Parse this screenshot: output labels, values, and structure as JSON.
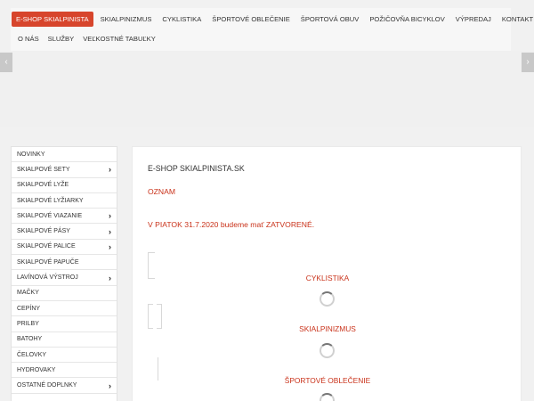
{
  "nav": {
    "row1": [
      "E-SHOP SKIALPINISTA",
      "SKIALPINIZMUS",
      "CYKLISTIKA",
      "ŠPORTOVÉ OBLEČENIE",
      "ŠPORTOVÁ OBUV",
      "POŽIČOVŇA BICYKLOV",
      "VÝPREDAJ",
      "KONTAKT"
    ],
    "row2": [
      "O NÁS",
      "SLUŽBY",
      "VEĽKOSTNÉ TABUĽKY"
    ]
  },
  "slider": {
    "prev_icon": "chevron-left-icon",
    "next_icon": "chevron-right-icon"
  },
  "sidebar": {
    "items": [
      {
        "label": "NOVINKY",
        "has_submenu": false
      },
      {
        "label": "SKIALPOVÉ SETY",
        "has_submenu": true
      },
      {
        "label": "SKIALPOVÉ LYŽE",
        "has_submenu": false
      },
      {
        "label": "SKIALPOVÉ LYŽIARKY",
        "has_submenu": false
      },
      {
        "label": "SKIALPOVÉ VIAZANIE",
        "has_submenu": true
      },
      {
        "label": "SKIALPOVÉ PÁSY",
        "has_submenu": true
      },
      {
        "label": "SKIALPOVÉ PALICE",
        "has_submenu": true
      },
      {
        "label": "SKIALPOVÉ PAPUČE",
        "has_submenu": false
      },
      {
        "label": "LAVÍNOVÁ VÝSTROJ",
        "has_submenu": true
      },
      {
        "label": "MAČKY",
        "has_submenu": false
      },
      {
        "label": "CEPÍNY",
        "has_submenu": false
      },
      {
        "label": "PRILBY",
        "has_submenu": false
      },
      {
        "label": "BATOHY",
        "has_submenu": false
      },
      {
        "label": "ČELOVKY",
        "has_submenu": false
      },
      {
        "label": "HYDROVAKY",
        "has_submenu": false
      },
      {
        "label": "OSTATNÉ DOPLNKY",
        "has_submenu": true
      }
    ]
  },
  "main": {
    "title": "E-SHOP SKIALPINISTA.SK",
    "oznam": "OZNAM",
    "notice": "V PIATOK 31.7.2020 budeme mať ZATVORENÉ.",
    "categories": [
      "CYKLISTIKA",
      "SKIALPINIZMUS",
      "ŠPORTOVÉ OBLEČENIE"
    ]
  },
  "colors": {
    "accent": "#d7452c",
    "link_red": "#c9321a"
  }
}
